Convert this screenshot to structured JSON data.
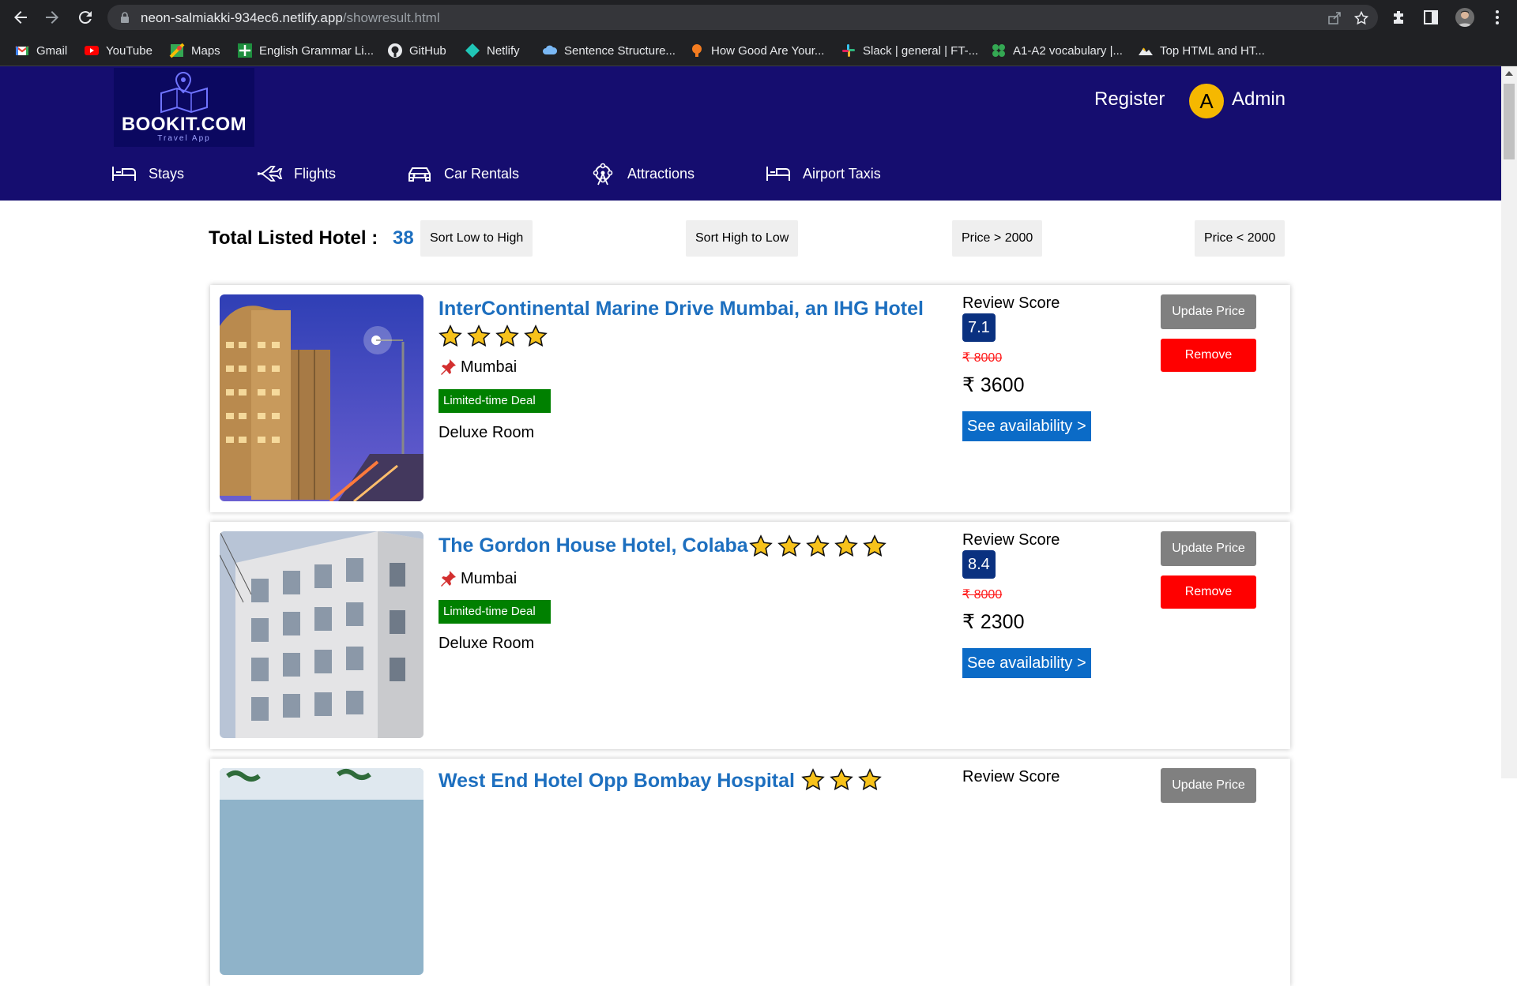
{
  "browser": {
    "url_host": "neon-salmiakki-934ec6.netlify.app",
    "url_path": "/showresult.html",
    "bookmarks": [
      {
        "label": "Gmail",
        "icon": "gmail-icon"
      },
      {
        "label": "YouTube",
        "icon": "youtube-icon"
      },
      {
        "label": "Maps",
        "icon": "maps-icon"
      },
      {
        "label": "English Grammar Li...",
        "icon": "grammar-icon"
      },
      {
        "label": "GitHub",
        "icon": "github-icon"
      },
      {
        "label": "Netlify",
        "icon": "netlify-icon"
      },
      {
        "label": "Sentence Structure...",
        "icon": "cloud-icon"
      },
      {
        "label": "How Good Are Your...",
        "icon": "bulb-icon"
      },
      {
        "label": "Slack | general | FT-...",
        "icon": "slack-icon"
      },
      {
        "label": "A1-A2 vocabulary |...",
        "icon": "clover-icon"
      },
      {
        "label": "Top HTML and HT...",
        "icon": "mountain-icon"
      }
    ]
  },
  "header": {
    "logo_name": "BOOKIT.COM",
    "logo_tagline": "Travel App",
    "register": "Register",
    "avatar_letter": "A",
    "user": "Admin",
    "tabs": [
      {
        "label": "Stays",
        "icon": "bed-icon"
      },
      {
        "label": "Flights",
        "icon": "plane-icon"
      },
      {
        "label": "Car Rentals",
        "icon": "car-icon"
      },
      {
        "label": "Attractions",
        "icon": "attractions-icon"
      },
      {
        "label": "Airport Taxis",
        "icon": "taxi-icon"
      }
    ],
    "colors": {
      "header_bg": "#150d6f",
      "link_blue": "#1d6fbf"
    }
  },
  "filters": {
    "total_label": "Total Listed Hotel :",
    "total_count": "38",
    "sort_low_high": "Sort Low to High",
    "sort_high_low": "Sort High to Low",
    "price_gt": "Price > 2000",
    "price_lt": "Price < 2000"
  },
  "hotels": [
    {
      "name": "InterContinental Marine Drive Mumbai, an IHG Hotel",
      "stars": 4,
      "location": "Mumbai",
      "deal": "Limited-time Deal",
      "room": "Deluxe Room",
      "review_label": "Review Score",
      "score": "7.1",
      "old_price": "₹ 8000",
      "price": "₹ 3600",
      "availability": "See availability >",
      "update": "Update Price",
      "remove": "Remove"
    },
    {
      "name": "The Gordon House Hotel, Colaba",
      "stars": 5,
      "location": "Mumbai",
      "deal": "Limited-time Deal",
      "room": "Deluxe Room",
      "review_label": "Review Score",
      "score": "8.4",
      "old_price": "₹ 8000",
      "price": "₹ 2300",
      "availability": "See availability >",
      "update": "Update Price",
      "remove": "Remove"
    },
    {
      "name": "West End Hotel Opp Bombay Hospital",
      "stars": 3,
      "review_label": "Review Score",
      "update": "Update Price"
    }
  ]
}
